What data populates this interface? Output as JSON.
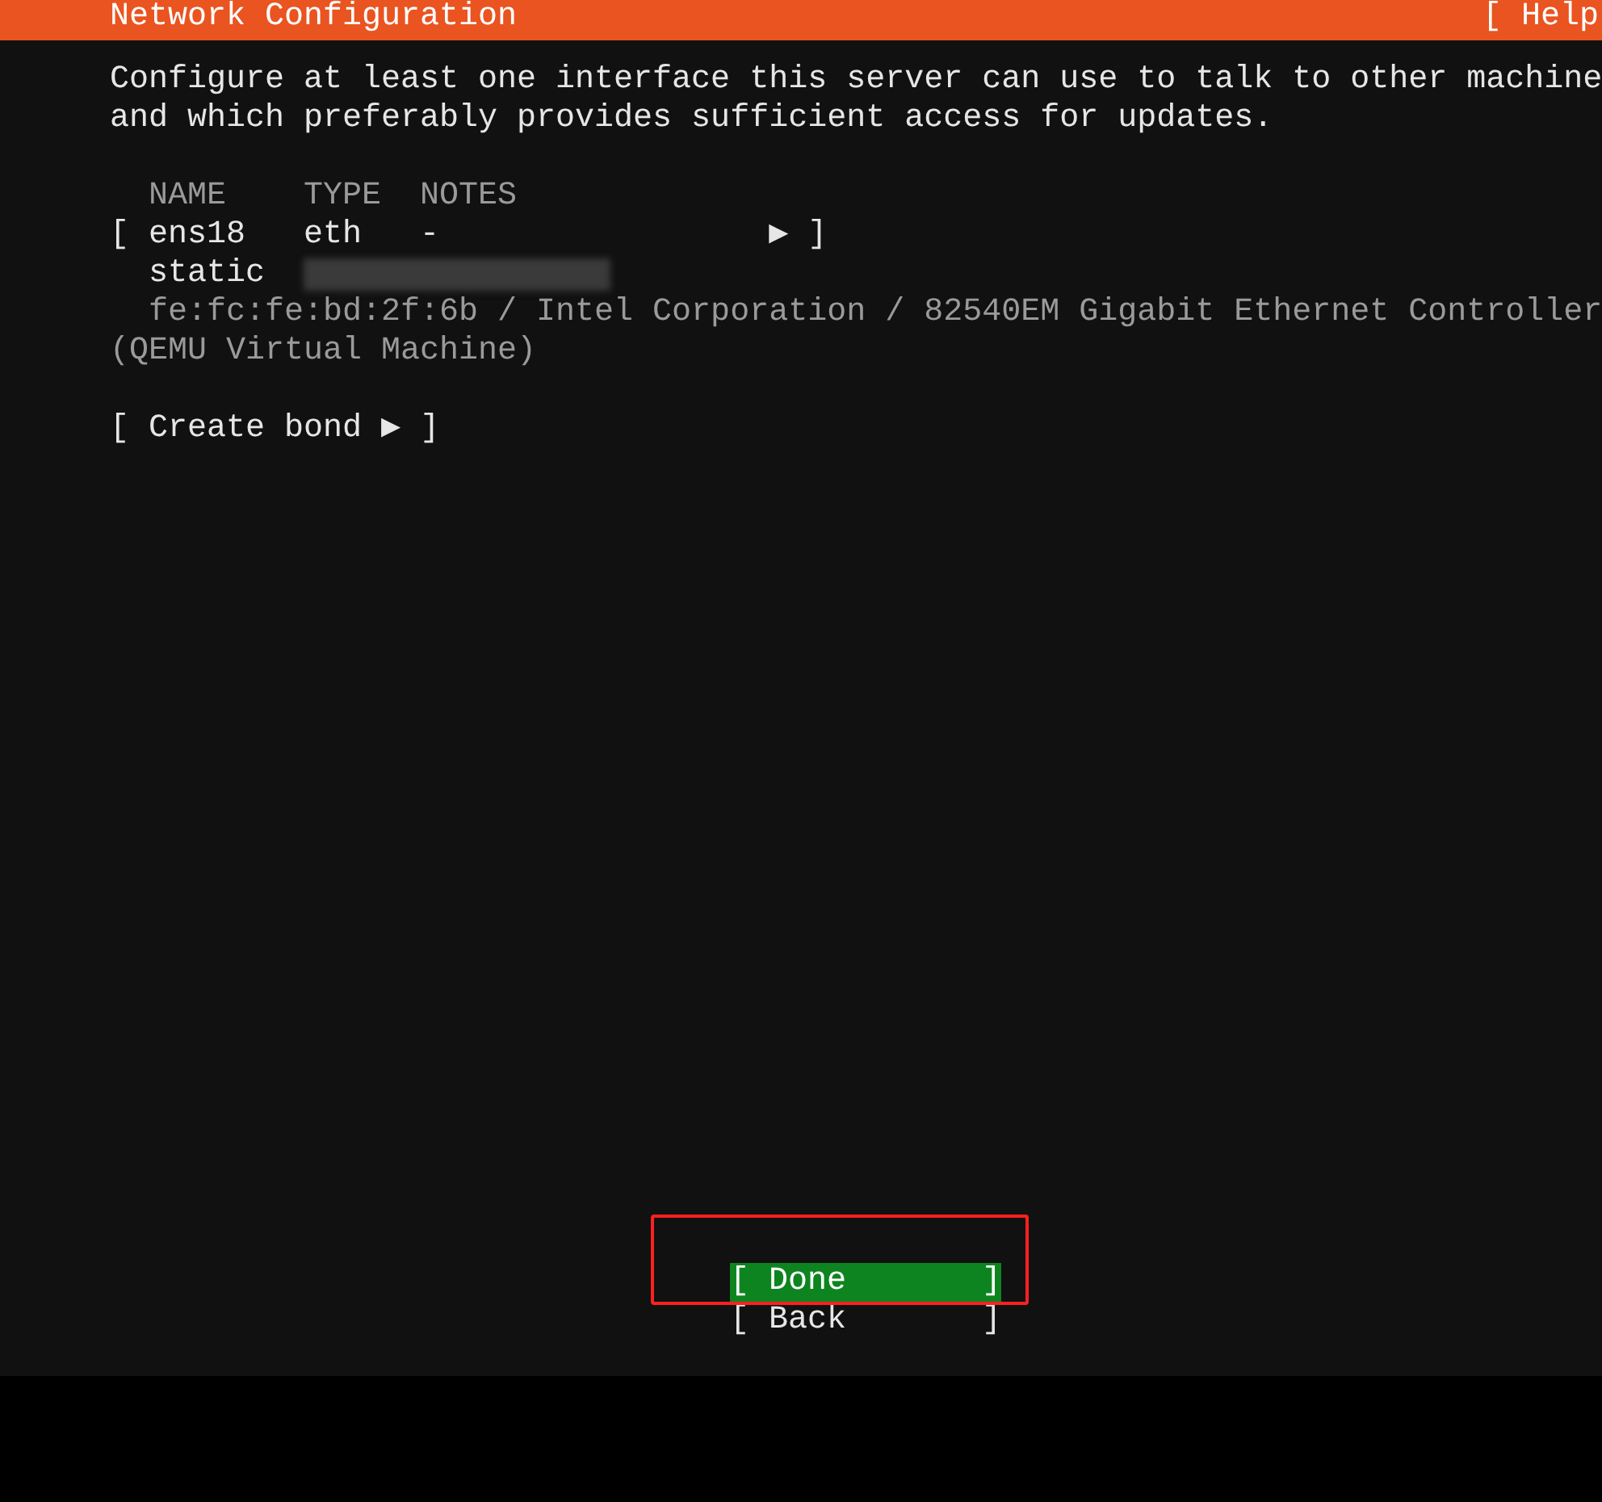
{
  "header": {
    "title": "Network Configuration",
    "help": "[ Help"
  },
  "intro": [
    "Configure at least one interface this server can use to talk to other machine",
    "and which preferably provides sufficient access for updates."
  ],
  "table": {
    "columns": [
      "NAME",
      "TYPE",
      "NOTES"
    ],
    "interfaces": [
      {
        "open": "[",
        "name": "ens18",
        "type": "eth",
        "notes": "-",
        "arrow": "▶",
        "close": "]",
        "method": "static",
        "detail_lines": [
          "fe:fc:fe:bd:2f:6b / Intel Corporation / 82540EM Gigabit Ethernet Controller",
          "(QEMU Virtual Machine)"
        ]
      }
    ]
  },
  "create_bond": {
    "open": "[",
    "label": "Create bond",
    "arrow": "▶",
    "close": "]"
  },
  "buttons": [
    {
      "open": "[",
      "label": "Done",
      "close": "]",
      "selected": true
    },
    {
      "open": "[",
      "label": "Back",
      "close": "]",
      "selected": false
    }
  ]
}
